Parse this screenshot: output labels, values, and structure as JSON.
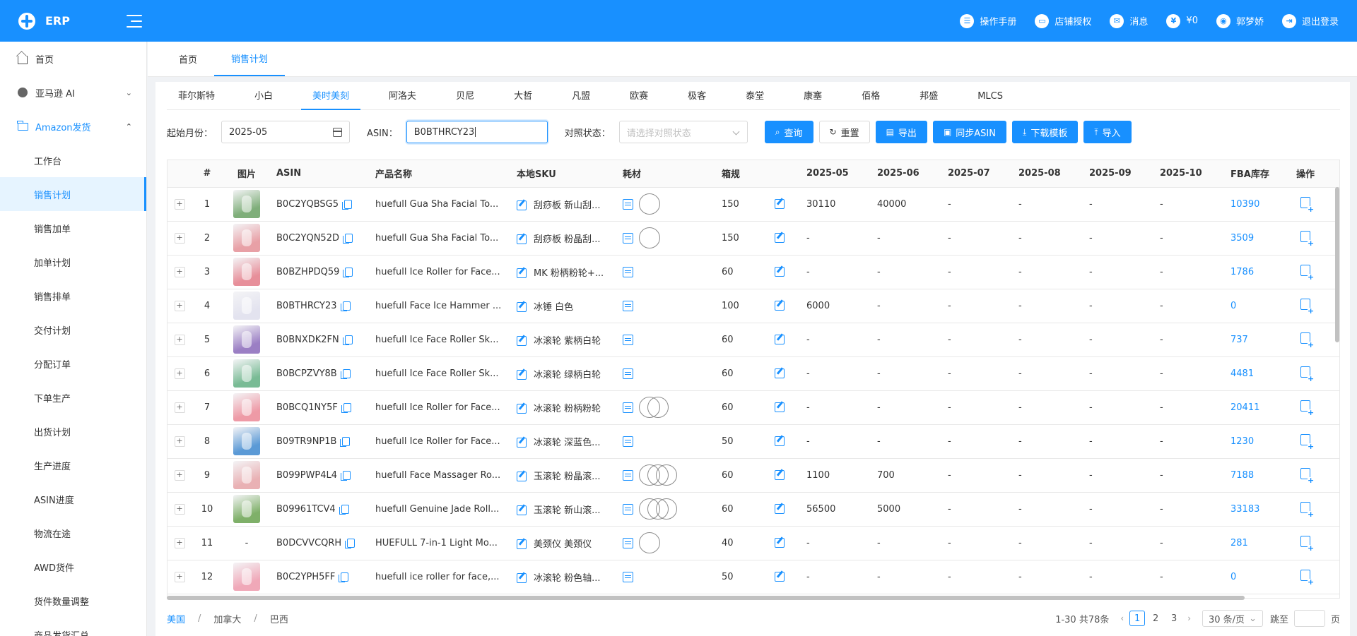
{
  "app": {
    "name": "ERP"
  },
  "topbar": {
    "items": [
      {
        "icon": "manual-icon",
        "label": "操作手册"
      },
      {
        "icon": "store-icon",
        "label": "店铺授权"
      },
      {
        "icon": "message-icon",
        "label": "消息"
      },
      {
        "icon": "wallet-icon",
        "label": "¥0"
      },
      {
        "icon": "user-icon",
        "label": "郭梦娇"
      },
      {
        "icon": "logout-icon",
        "label": "退出登录"
      }
    ]
  },
  "sidebar": {
    "items": [
      {
        "label": "首页",
        "icon": "home-icon"
      },
      {
        "label": "亚马逊 AI",
        "icon": "ai-icon"
      },
      {
        "label": "Amazon发货",
        "icon": "folder-icon"
      }
    ],
    "sub_items": [
      "工作台",
      "销售计划",
      "销售加单",
      "加单计划",
      "销售排单",
      "交付计划",
      "分配订单",
      "下单生产",
      "出货计划",
      "生产进度",
      "ASIN进度",
      "物流在途",
      "AWD货件",
      "货件数量调整",
      "商品发货汇总"
    ],
    "active_sub": "销售计划"
  },
  "page_tabs": [
    "首页",
    "销售计划"
  ],
  "brand_tabs": [
    "菲尔斯特",
    "小白",
    "美时美刻",
    "阿洛夫",
    "贝尼",
    "大哲",
    "凡盟",
    "欧赛",
    "极客",
    "泰堂",
    "康塞",
    "佰格",
    "邦盛",
    "MLCS"
  ],
  "filters": {
    "month_label": "起始月份：",
    "month_value": "2025-05",
    "asin_label": "ASIN：",
    "asin_value": "B0BTHRCY23",
    "status_label": "对照状态：",
    "status_placeholder": "请选择对照状态"
  },
  "buttons": {
    "search": "查询",
    "reset": "重置",
    "export": "导出",
    "sync": "同步ASIN",
    "download": "下载模板",
    "import": "导入"
  },
  "table": {
    "headers": [
      "#",
      "图片",
      "ASIN",
      "产品名称",
      "本地SKU",
      "耗材",
      "箱规",
      "",
      "2025-05",
      "2025-06",
      "2025-07",
      "2025-08",
      "2025-09",
      "2025-10",
      "FBA库存",
      "操作"
    ],
    "rows": [
      {
        "no": "1",
        "img": "#7fae7a",
        "asin": "B0C2YQBSG5",
        "name": "huefull Gua Sha Facial To...",
        "sku": "刮痧板 新山刮...",
        "circles": 1,
        "box": "150",
        "m05": "30110",
        "m06": "40000",
        "m07": "-",
        "m08": "-",
        "m09": "-",
        "m10": "-",
        "fba": "10390"
      },
      {
        "no": "2",
        "img": "#e8a0a6",
        "asin": "B0C2YQN52D",
        "name": "huefull Gua Sha Facial To...",
        "sku": "刮痧板 粉晶刮...",
        "circles": 1,
        "box": "150",
        "m05": "-",
        "m06": "-",
        "m07": "-",
        "m08": "-",
        "m09": "-",
        "m10": "-",
        "fba": "3509"
      },
      {
        "no": "3",
        "img": "#e78f9a",
        "asin": "B0BZHPDQ59",
        "name": "huefull Ice Roller for Face...",
        "sku": "MK 粉柄粉轮+...",
        "circles": 0,
        "box": "60",
        "m05": "-",
        "m06": "-",
        "m07": "-",
        "m08": "-",
        "m09": "-",
        "m10": "-",
        "fba": "1786"
      },
      {
        "no": "4",
        "img": "#e3e3ef",
        "asin": "B0BTHRCY23",
        "name": "huefull Face Ice Hammer ...",
        "sku": "冰锤 白色",
        "circles": 0,
        "box": "100",
        "m05": "6000",
        "m06": "-",
        "m07": "-",
        "m08": "-",
        "m09": "-",
        "m10": "-",
        "fba": "0"
      },
      {
        "no": "5",
        "img": "#9b7fc4",
        "asin": "B0BNXDK2FN",
        "name": "huefull Ice Face Roller Sk...",
        "sku": "冰滚轮 紫柄白轮",
        "circles": 0,
        "box": "60",
        "m05": "-",
        "m06": "-",
        "m07": "-",
        "m08": "-",
        "m09": "-",
        "m10": "-",
        "fba": "737"
      },
      {
        "no": "6",
        "img": "#79bb95",
        "asin": "B0BCPZVY8B",
        "name": "huefull Ice Face Roller Sk...",
        "sku": "冰滚轮 绿柄白轮",
        "circles": 0,
        "box": "60",
        "m05": "-",
        "m06": "-",
        "m07": "-",
        "m08": "-",
        "m09": "-",
        "m10": "-",
        "fba": "4481"
      },
      {
        "no": "7",
        "img": "#ee9aa6",
        "asin": "B0BCQ1NY5F",
        "name": "huefull Ice Roller for Face...",
        "sku": "冰滚轮 粉柄粉轮",
        "circles": 2,
        "box": "60",
        "m05": "-",
        "m06": "-",
        "m07": "-",
        "m08": "-",
        "m09": "-",
        "m10": "-",
        "fba": "20411"
      },
      {
        "no": "8",
        "img": "#5b9ad6",
        "asin": "B09TR9NP1B",
        "name": "huefull Ice Roller for Face...",
        "sku": "冰滚轮 深蓝色...",
        "circles": 0,
        "box": "50",
        "m05": "-",
        "m06": "-",
        "m07": "-",
        "m08": "-",
        "m09": "-",
        "m10": "-",
        "fba": "1230"
      },
      {
        "no": "9",
        "img": "#e9b1b4",
        "asin": "B099PWP4L4",
        "name": "huefull Face Massager Ro...",
        "sku": "玉滚轮 粉晶滚...",
        "circles": 3,
        "box": "60",
        "m05": "1100",
        "m06": "700",
        "m07": "-",
        "m08": "-",
        "m09": "-",
        "m10": "-",
        "fba": "7188"
      },
      {
        "no": "10",
        "img": "#7fb069",
        "asin": "B09961TCV4",
        "name": "huefull Genuine Jade Roll...",
        "sku": "玉滚轮 新山滚...",
        "circles": 3,
        "box": "60",
        "m05": "56500",
        "m06": "5000",
        "m07": "-",
        "m08": "-",
        "m09": "-",
        "m10": "-",
        "fba": "33183"
      },
      {
        "no": "11",
        "img": "",
        "asin": "B0DCVVCQRH",
        "name": "HUEFULL 7-in-1 Light Mo...",
        "sku": "美颈仪 美颈仪",
        "circles": 1,
        "box": "40",
        "m05": "-",
        "m06": "-",
        "m07": "-",
        "m08": "-",
        "m09": "-",
        "m10": "-",
        "fba": "281"
      },
      {
        "no": "12",
        "img": "#f0a8b8",
        "asin": "B0C2YPH5FF",
        "name": "huefull ice roller for face,...",
        "sku": "冰滚轮 粉色轴...",
        "circles": 0,
        "box": "50",
        "m05": "-",
        "m06": "-",
        "m07": "-",
        "m08": "-",
        "m09": "-",
        "m10": "-",
        "fba": "0"
      }
    ]
  },
  "footer": {
    "regions": [
      "美国",
      "加拿大",
      "巴西"
    ],
    "active_region": "美国",
    "total_text": "1-30 共78条",
    "pages": [
      "1",
      "2",
      "3"
    ],
    "current_page": "1",
    "page_size": "30 条/页",
    "jump_label": "跳至",
    "page_unit": "页"
  },
  "colors": {
    "primary": "#1890ff"
  }
}
